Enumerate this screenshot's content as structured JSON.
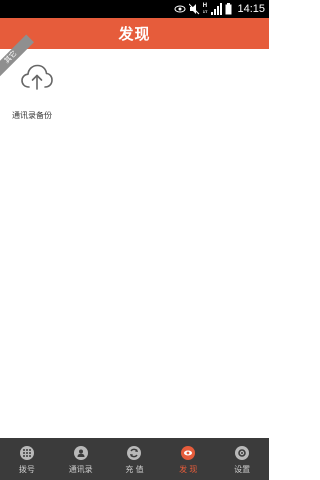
{
  "status_bar": {
    "time": "14:15",
    "network_label": "H",
    "network_sub": "1T",
    "icons": [
      "eye-icon",
      "mute-icon",
      "wifi-icon",
      "signal-icon",
      "battery-icon"
    ]
  },
  "header": {
    "title": "发现"
  },
  "content": {
    "ribbon": "其它",
    "feature": {
      "icon": "cloud-upload-icon",
      "label": "通讯录备份"
    }
  },
  "nav": {
    "items": [
      {
        "label": "拨号",
        "icon": "dialpad-icon",
        "active": false
      },
      {
        "label": "通讯录",
        "icon": "contact-icon",
        "active": false
      },
      {
        "label": "充 值",
        "icon": "recharge-icon",
        "active": false
      },
      {
        "label": "发 现",
        "icon": "discover-eye-icon",
        "active": true
      },
      {
        "label": "设置",
        "icon": "settings-icon",
        "active": false
      }
    ]
  },
  "colors": {
    "accent": "#e65c3b",
    "nav_bg": "#3b3b3b",
    "status_bg": "#000000"
  }
}
